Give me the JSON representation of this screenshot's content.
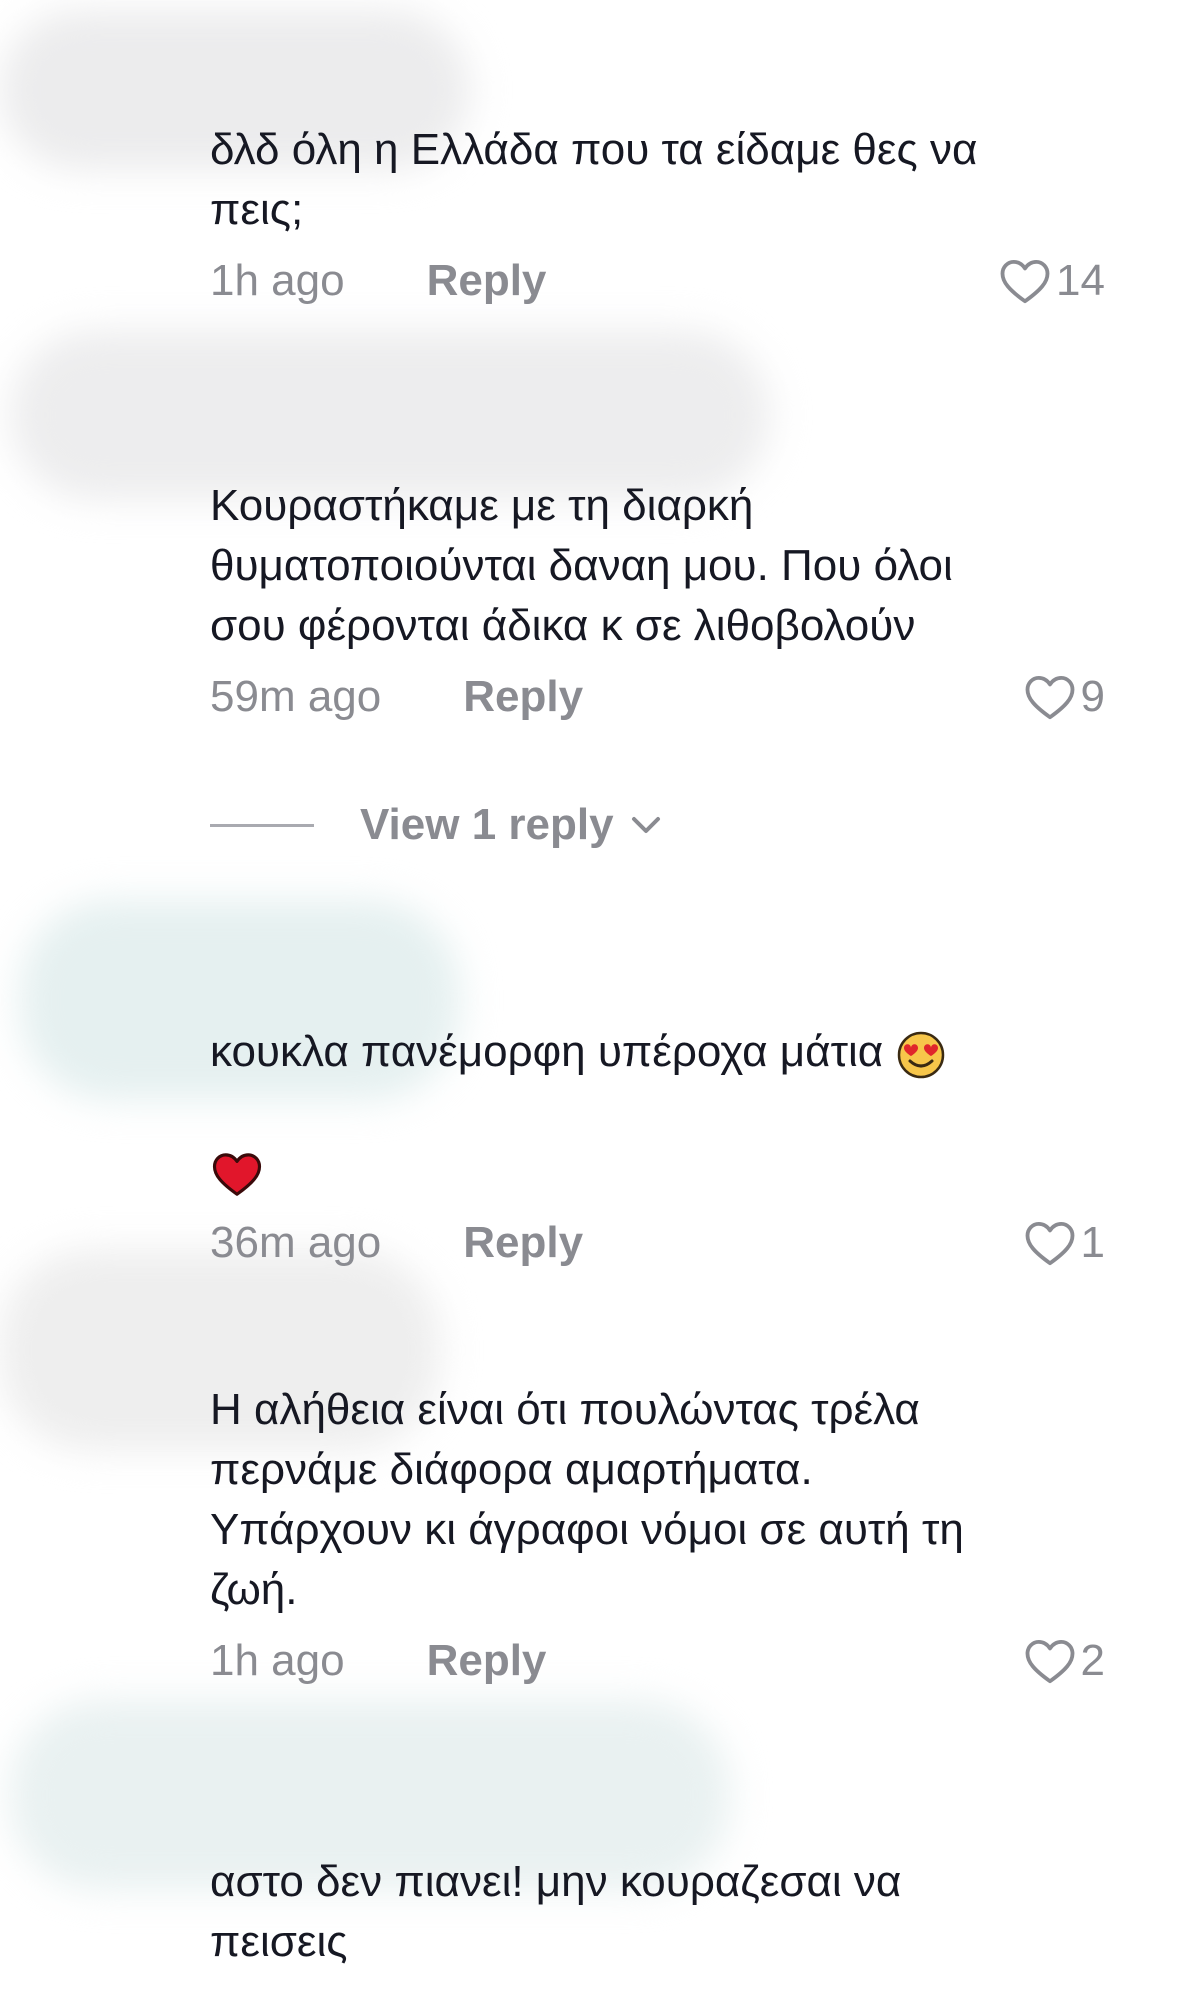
{
  "comments": [
    {
      "text": "δλδ όλη η Ελλάδα που τα είδαμε θες να\nπεις;",
      "time": "1h ago",
      "reply": "Reply",
      "likes": "14"
    },
    {
      "text": "Κουραστήκαμε με τη διαρκή\nθυματοποιούνται δαναη μου. Που όλοι\nσου φέρονται άδικα κ σε λιθοβολούν",
      "time": "59m ago",
      "reply": "Reply",
      "likes": "9"
    },
    {
      "text": "κουκλα πανέμορφη υπέροχα μάτια",
      "time": "36m ago",
      "reply": "Reply",
      "likes": "1"
    },
    {
      "text": "Η αλήθεια είναι ότι πουλώντας τρέλα\nπερνάμε διάφορα αμαρτήματα.\nΥπάρχουν κι άγραφοι νόμοι σε αυτή τη\nζωή.",
      "time": "1h ago",
      "reply": "Reply",
      "likes": "2"
    },
    {
      "text": "αστο δεν πιανει! μην κουραζεσαι να\nπεισεις"
    }
  ],
  "view_replies": "View 1 reply",
  "icons": {
    "like": "heart-outline-icon",
    "expand": "chevron-down-icon",
    "emoji_1": "smiling-face-with-heart-eyes-icon",
    "emoji_2": "red-heart-icon"
  },
  "colors": {
    "text": "#161823",
    "meta": "#8a8b91",
    "blur_gray": "#e9e9ea",
    "blur_teal": "#e6f1f1"
  }
}
